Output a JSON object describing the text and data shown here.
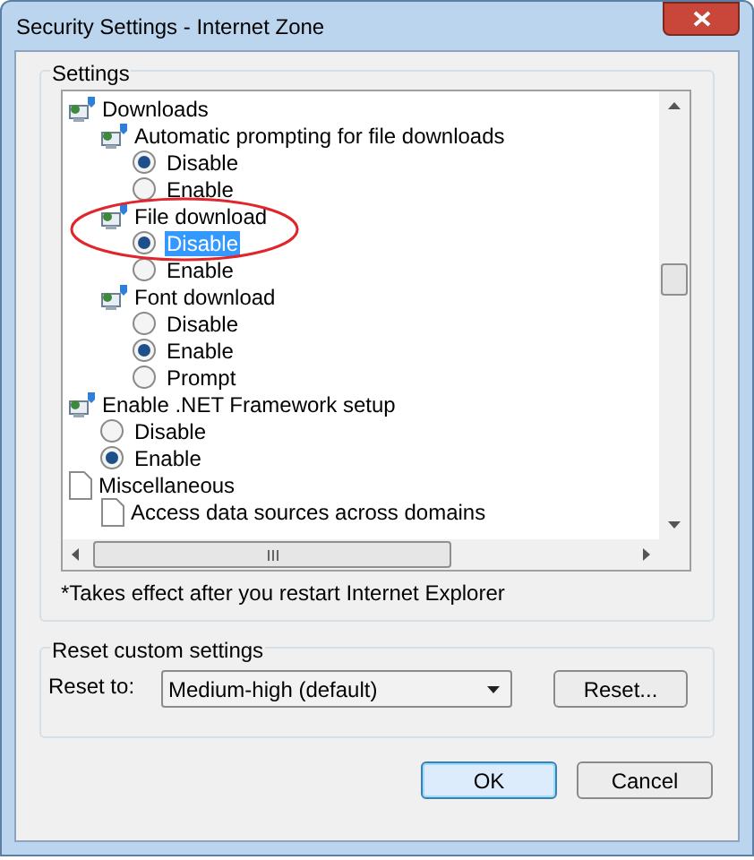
{
  "window": {
    "title": "Security Settings - Internet Zone"
  },
  "settings": {
    "label": "Settings",
    "items": [
      {
        "kind": "setting",
        "label": "Downloads",
        "children": [
          {
            "kind": "setting",
            "label": "Automatic prompting for file downloads",
            "children": [
              {
                "kind": "option",
                "label": "Disable",
                "selected": true,
                "highlighted": false
              },
              {
                "kind": "option",
                "label": "Enable",
                "selected": false,
                "highlighted": false
              }
            ]
          },
          {
            "kind": "setting",
            "label": "File download",
            "circled": true,
            "children": [
              {
                "kind": "option",
                "label": "Disable",
                "selected": true,
                "highlighted": true
              },
              {
                "kind": "option",
                "label": "Enable",
                "selected": false,
                "highlighted": false
              }
            ]
          },
          {
            "kind": "setting",
            "label": "Font download",
            "children": [
              {
                "kind": "option",
                "label": "Disable",
                "selected": false,
                "highlighted": false
              },
              {
                "kind": "option",
                "label": "Enable",
                "selected": true,
                "highlighted": false
              },
              {
                "kind": "option",
                "label": "Prompt",
                "selected": false,
                "highlighted": false
              }
            ]
          }
        ]
      },
      {
        "kind": "setting",
        "label": "Enable .NET Framework setup",
        "children": [
          {
            "kind": "option",
            "label": "Disable",
            "selected": false,
            "highlighted": false
          },
          {
            "kind": "option",
            "label": "Enable",
            "selected": true,
            "highlighted": false
          }
        ]
      },
      {
        "kind": "section",
        "label": "Miscellaneous",
        "children": [
          {
            "kind": "section",
            "label": "Access data sources across domains"
          }
        ]
      }
    ],
    "note": "*Takes effect after you restart Internet Explorer"
  },
  "reset": {
    "label": "Reset custom settings",
    "field_label": "Reset to:",
    "value": "Medium-high (default)",
    "button": "Reset..."
  },
  "buttons": [
    {
      "label": "OK",
      "default": true
    },
    {
      "label": "Cancel",
      "default": false
    }
  ]
}
